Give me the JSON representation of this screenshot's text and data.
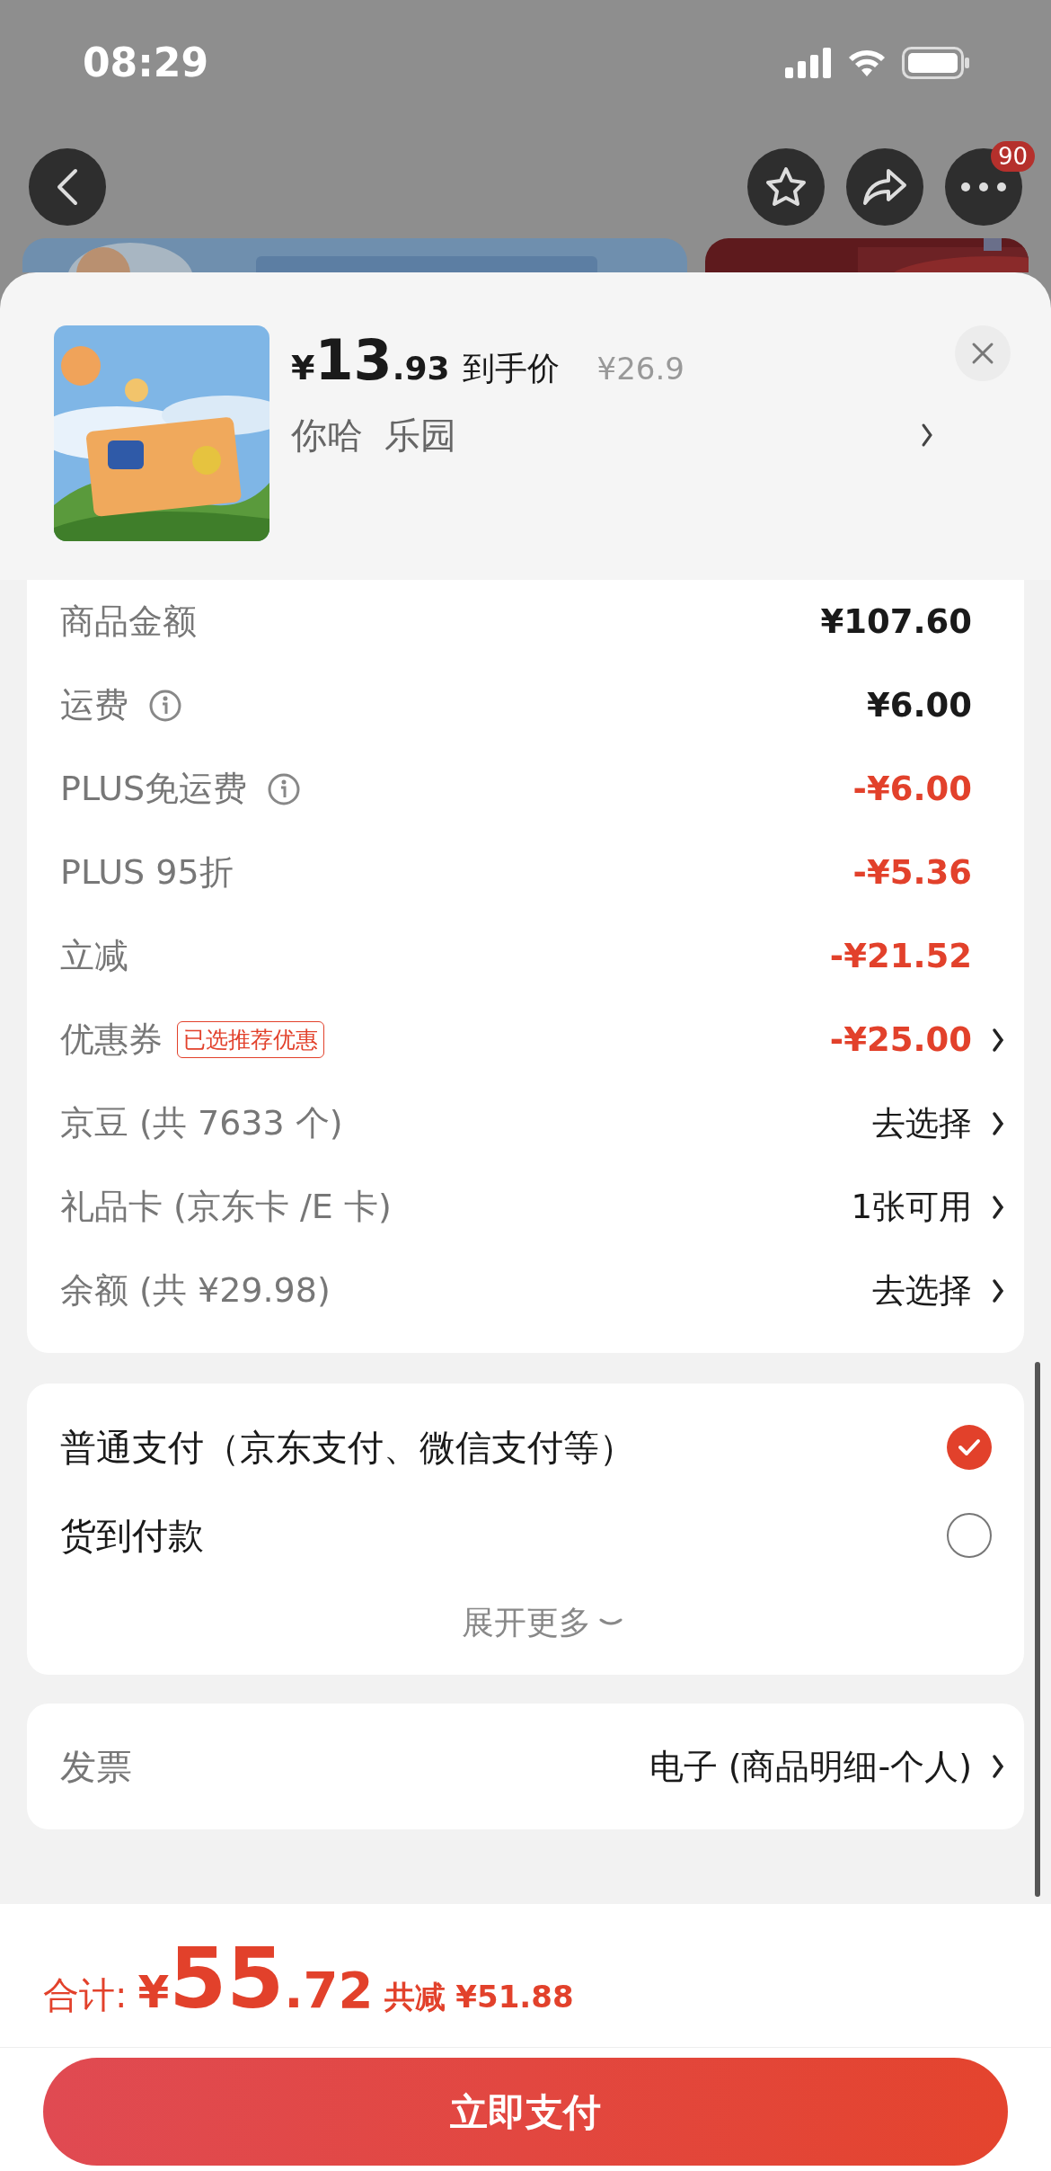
{
  "status_bar": {
    "time": "08:29"
  },
  "top_bar": {
    "more_badge": "90"
  },
  "product": {
    "currency": "¥",
    "price_integer": "13",
    "price_decimal": ".93",
    "price_label": "到手价",
    "original_price": "¥26.9",
    "spec": [
      "你哈",
      "乐园"
    ]
  },
  "fees": [
    {
      "label": "商品金额",
      "value": "¥107.60",
      "kind": "amount",
      "info": false,
      "arrow": false
    },
    {
      "label": "运费",
      "value": "¥6.00",
      "kind": "amount",
      "info": true,
      "arrow": false
    },
    {
      "label": "PLUS免运费",
      "value": "-¥6.00",
      "kind": "discount",
      "info": true,
      "arrow": false
    },
    {
      "label": "PLUS 95折",
      "value": "-¥5.36",
      "kind": "discount",
      "info": false,
      "arrow": false
    },
    {
      "label": "立减",
      "value": "-¥21.52",
      "kind": "discount",
      "info": false,
      "arrow": false
    },
    {
      "label": "优惠券",
      "tag": "已选推荐优惠",
      "value": "-¥25.00",
      "kind": "discount",
      "info": false,
      "arrow": true
    },
    {
      "label": "京豆 (共 7633 个)",
      "value": "去选择",
      "kind": "action",
      "info": false,
      "arrow": true
    },
    {
      "label": "礼品卡 (京东卡 /E 卡)",
      "value": "1张可用",
      "kind": "action",
      "info": false,
      "arrow": true
    },
    {
      "label": "余额 (共 ¥29.98)",
      "value": "去选择",
      "kind": "action",
      "info": false,
      "arrow": true
    }
  ],
  "payment": {
    "options": [
      {
        "label": "普通支付（京东支付、微信支付等）",
        "selected": true
      },
      {
        "label": "货到付款",
        "selected": false
      }
    ],
    "more": "展开更多"
  },
  "invoice": {
    "label": "发票",
    "value": "电子 (商品明细-个人)"
  },
  "total": {
    "label": "合计:",
    "currency": "¥",
    "integer": "55",
    "decimal": ".72",
    "saved": "共减 ¥51.88"
  },
  "pay_button": "立即支付"
}
